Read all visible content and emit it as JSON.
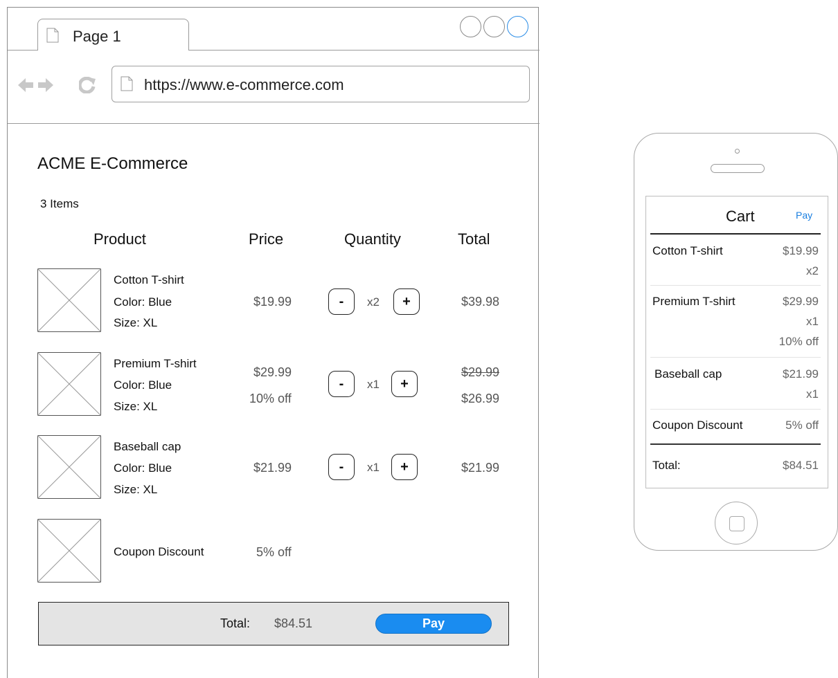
{
  "browser": {
    "tab": {
      "label": "Page 1"
    },
    "url": "https://www.e-commerce.com"
  },
  "store": {
    "title": "ACME E-Commerce",
    "item_count": "3 Items",
    "columns": {
      "product": "Product",
      "price": "Price",
      "quantity": "Quantity",
      "total": "Total"
    },
    "rows": [
      {
        "name": "Cotton T-shirt",
        "color": "Color: Blue",
        "size": "Size: XL",
        "price": "$19.99",
        "qty": "x2",
        "total": "$39.98"
      },
      {
        "name": "Premium T-shirt",
        "color": "Color: Blue",
        "size": "Size: XL",
        "price": "$29.99",
        "discount": "10% off",
        "qty": "x1",
        "total_original": "$29.99",
        "total": "$26.99"
      },
      {
        "name": "Baseball cap",
        "color": "Color: Blue",
        "size": "Size: XL",
        "price": "$21.99",
        "qty": "x1",
        "total": "$21.99"
      }
    ],
    "coupon": {
      "name": "Coupon Discount",
      "value": "5% off"
    },
    "qty_minus": "-",
    "qty_plus": "+",
    "footer": {
      "total_label": "Total:",
      "total_value": "$84.51",
      "pay_label": "Pay"
    }
  },
  "mobile": {
    "title": "Cart",
    "pay_label": "Pay",
    "items": [
      {
        "name": "Cotton T-shirt",
        "price": "$19.99",
        "qty": "x2"
      },
      {
        "name": "Premium T-shirt",
        "price": "$29.99",
        "qty": "x1",
        "discount": "10% off"
      },
      {
        "name": "Baseball cap",
        "price": "$21.99",
        "qty": "x1"
      }
    ],
    "coupon": {
      "name": "Coupon Discount",
      "value": "5% off"
    },
    "total": {
      "label": "Total:",
      "value": "$84.51"
    }
  },
  "colors": {
    "accent": "#1a8cf0",
    "footer_bg": "#e4e4e4",
    "border": "#8a8a8a"
  }
}
